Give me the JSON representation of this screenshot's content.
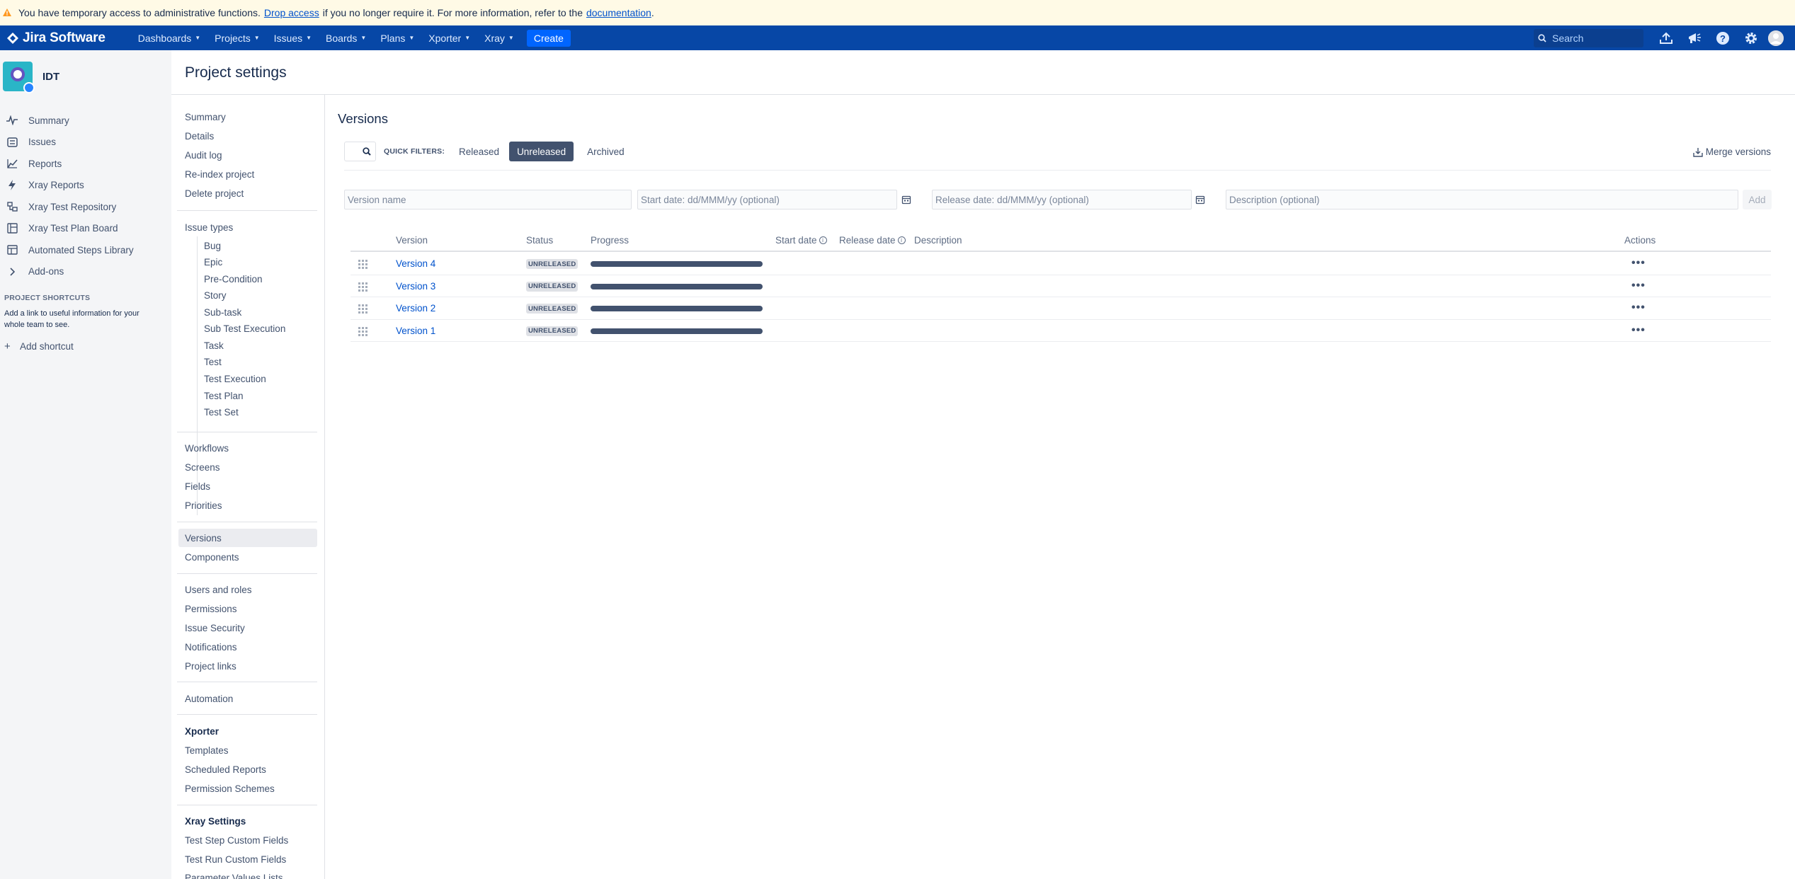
{
  "banner": {
    "text_before": "You have temporary access to administrative functions.",
    "link_drop": "Drop access",
    "text_middle": "if you no longer require it. For more information, refer to the",
    "link_docs": "documentation",
    "text_end": "."
  },
  "topnav": {
    "product": "Jira Software",
    "menu": [
      "Dashboards",
      "Projects",
      "Issues",
      "Boards",
      "Plans",
      "Xporter",
      "Xray"
    ],
    "create": "Create",
    "search_placeholder": "Search",
    "accent": "#0747a6"
  },
  "project": {
    "name": "IDT",
    "nav": [
      {
        "label": "Summary",
        "icon": "pulse-icon"
      },
      {
        "label": "Issues",
        "icon": "issues-icon"
      },
      {
        "label": "Reports",
        "icon": "chart-icon"
      },
      {
        "label": "Xray Reports",
        "icon": "lightning-icon"
      },
      {
        "label": "Xray Test Repository",
        "icon": "repository-icon"
      },
      {
        "label": "Xray Test Plan Board",
        "icon": "board-icon"
      },
      {
        "label": "Automated Steps Library",
        "icon": "library-icon"
      },
      {
        "label": "Add-ons",
        "icon": "chevron-right-icon"
      }
    ],
    "shortcuts_label": "PROJECT SHORTCUTS",
    "shortcuts_desc": "Add a link to useful information for your whole team to see.",
    "add_shortcut": "Add shortcut"
  },
  "settings": {
    "title": "Project settings",
    "menu_top": [
      "Summary",
      "Details",
      "Audit log",
      "Re-index project",
      "Delete project"
    ],
    "issue_types_label": "Issue types",
    "issue_types": [
      "Bug",
      "Epic",
      "Pre-Condition",
      "Story",
      "Sub-task",
      "Sub Test Execution",
      "Task",
      "Test",
      "Test Execution",
      "Test Plan",
      "Test Set"
    ],
    "menu_workflow": [
      "Workflows",
      "Screens",
      "Fields",
      "Priorities"
    ],
    "menu_versions": [
      "Versions",
      "Components"
    ],
    "menu_users": [
      "Users and roles",
      "Permissions",
      "Issue Security",
      "Notifications",
      "Project links"
    ],
    "menu_automation": [
      "Automation"
    ],
    "xporter_header": "Xporter",
    "menu_xporter": [
      "Templates",
      "Scheduled Reports",
      "Permission Schemes"
    ],
    "xray_header": "Xray Settings",
    "menu_xray": [
      "Test Step Custom Fields",
      "Test Run Custom Fields",
      "Parameter Values Lists"
    ]
  },
  "versions": {
    "title": "Versions",
    "quick_filters_label": "QUICK FILTERS:",
    "filters": [
      "Released",
      "Unreleased",
      "Archived"
    ],
    "active_filter": "Unreleased",
    "merge": "Merge versions",
    "form": {
      "name_placeholder": "Version name",
      "start_placeholder": "Start date: dd/MMM/yy (optional)",
      "release_placeholder": "Release date: dd/MMM/yy (optional)",
      "desc_placeholder": "Description (optional)",
      "add": "Add"
    },
    "columns": {
      "version": "Version",
      "status": "Status",
      "progress": "Progress",
      "start_date": "Start date",
      "release_date": "Release date",
      "description": "Description",
      "actions": "Actions"
    },
    "rows": [
      {
        "name": "Version 4",
        "status": "UNRELEASED",
        "actions": "•••"
      },
      {
        "name": "Version 3",
        "status": "UNRELEASED",
        "actions": "•••"
      },
      {
        "name": "Version 2",
        "status": "UNRELEASED",
        "actions": "•••"
      },
      {
        "name": "Version 1",
        "status": "UNRELEASED",
        "actions": "•••"
      }
    ]
  }
}
